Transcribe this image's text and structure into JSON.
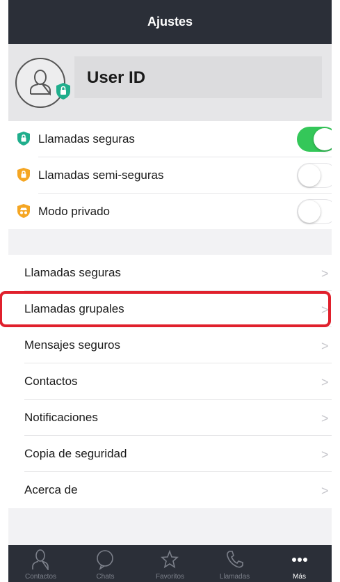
{
  "header": {
    "title": "Ajustes"
  },
  "profile": {
    "user_id": "User ID"
  },
  "toggles": [
    {
      "label": "Llamadas seguras",
      "icon": "shield-green-icon",
      "color": "#1fae8c",
      "state": "on"
    },
    {
      "label": "Llamadas semi-seguras",
      "icon": "shield-orange-icon",
      "color": "#f5a623",
      "state": "off"
    },
    {
      "label": "Modo  privado",
      "icon": "incognito-orange-icon",
      "color": "#f5a623",
      "state": "off"
    }
  ],
  "menu": [
    {
      "label": "Llamadas seguras"
    },
    {
      "label": "Llamadas grupales",
      "highlighted": true
    },
    {
      "label": "Mensajes seguros"
    },
    {
      "label": "Contactos"
    },
    {
      "label": "Notificaciones"
    },
    {
      "label": "Copia de seguridad"
    },
    {
      "label": "Acerca de"
    }
  ],
  "chevron": ">",
  "tabbar": [
    {
      "label": "Contactos",
      "icon": "person-icon"
    },
    {
      "label": "Chats",
      "icon": "chat-bubble-icon"
    },
    {
      "label": "Favoritos",
      "icon": "star-icon"
    },
    {
      "label": "Llamadas",
      "icon": "phone-icon"
    },
    {
      "label": "Más",
      "icon": "more-dots-icon",
      "active": true
    }
  ],
  "colors": {
    "header_bg": "#2b2f38",
    "switch_on": "#34c759",
    "highlight_border": "#e0202c"
  }
}
